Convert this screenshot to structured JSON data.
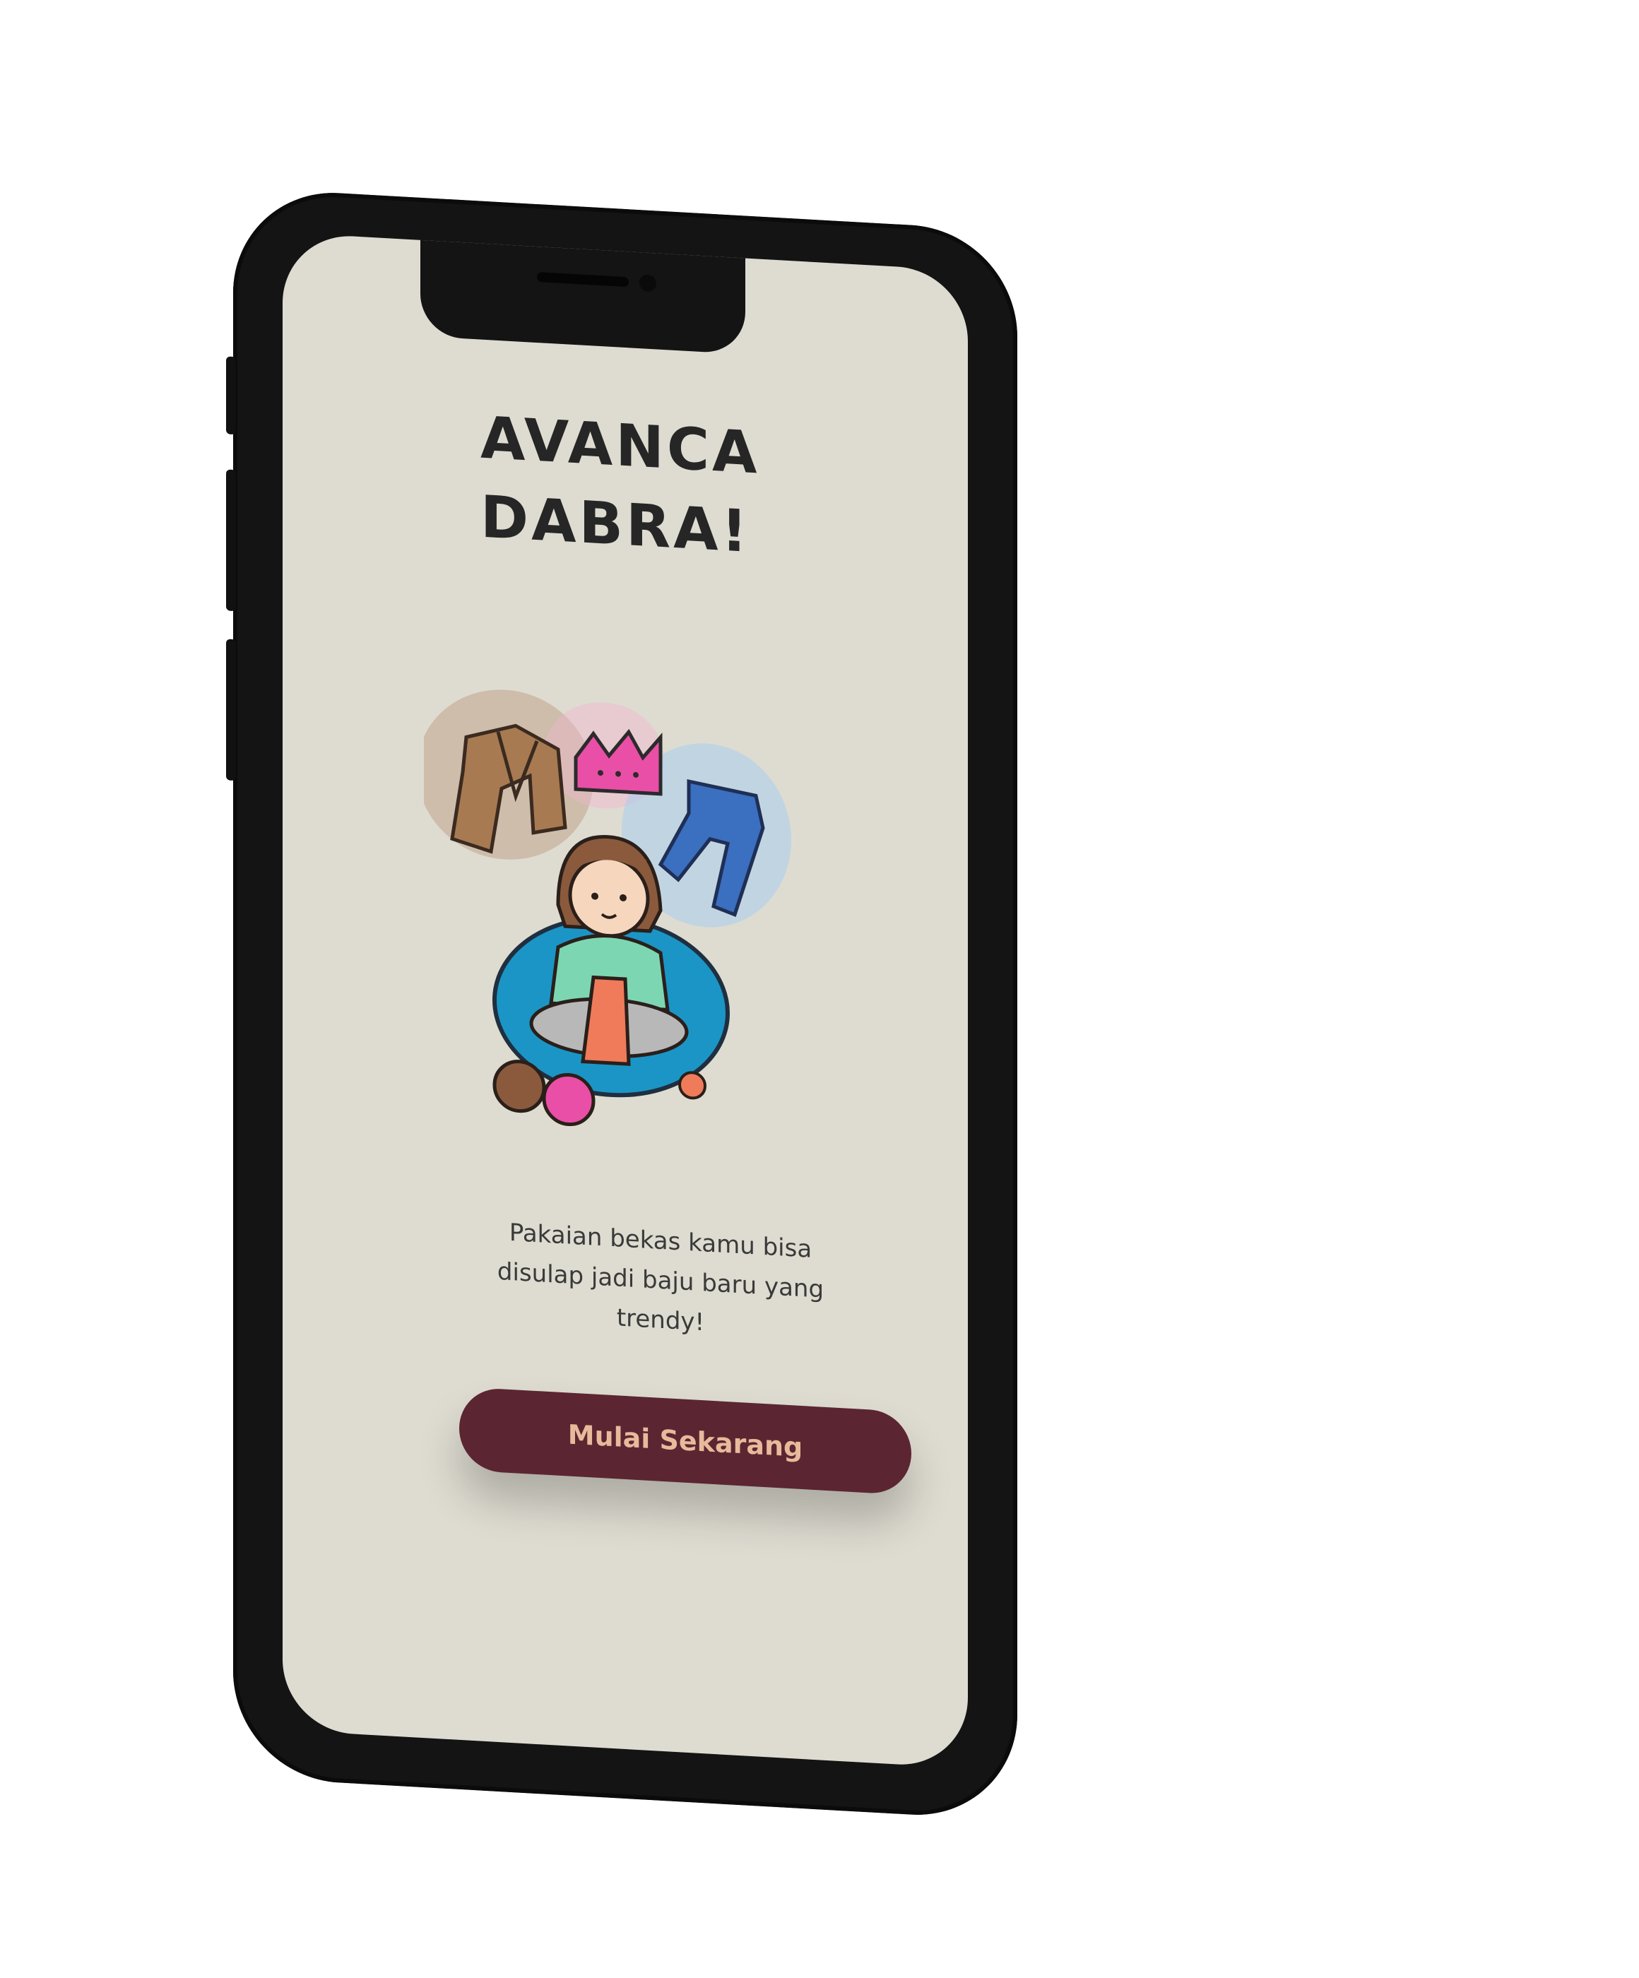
{
  "app": {
    "title_line1": "AVANCA",
    "title_line2": "DABRA!",
    "description": "Pakaian bekas kamu bisa disulap jadi baju baru yang trendy!",
    "cta_label": "Mulai Sekarang"
  },
  "colors": {
    "screen_bg": "#dedcd1",
    "title": "#262626",
    "button_bg": "#5c2532",
    "button_text": "#e9b99b",
    "phone_frame": "#141414"
  },
  "icons": {
    "illustration": "girl-knitting-illustration"
  }
}
